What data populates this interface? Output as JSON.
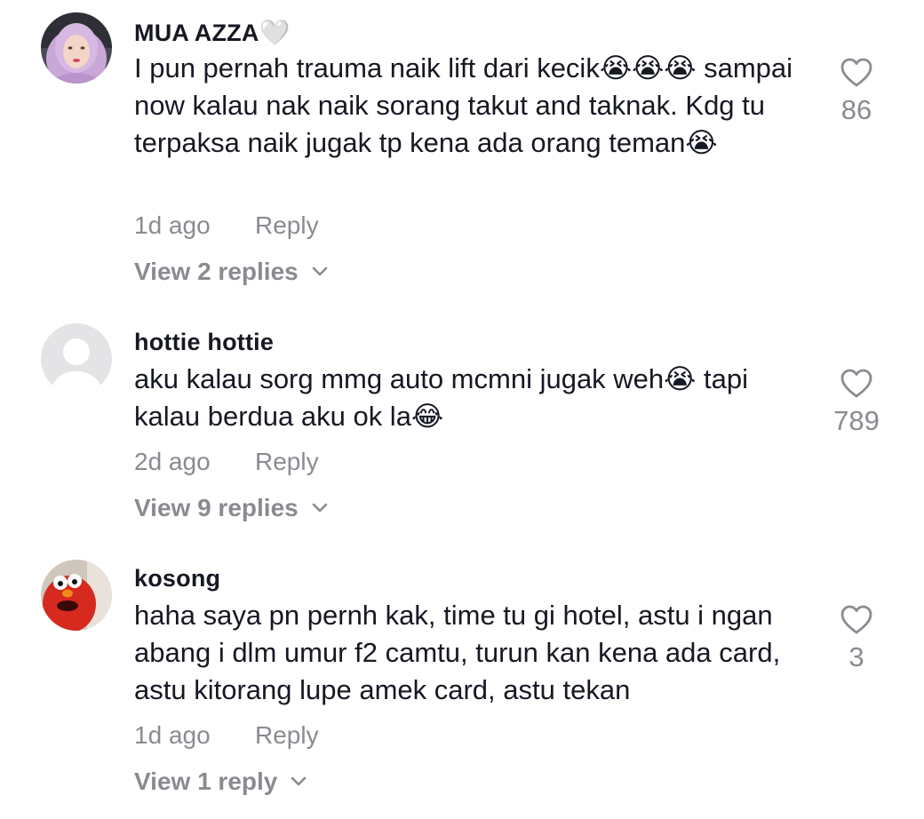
{
  "comments": [
    {
      "username": "MUA AZZA",
      "username_suffix": "🤍",
      "text": "I pun pernah trauma naik lift dari kecik😭😭😭 sampai now kalau nak naik sorang takut and taknak. Kdg tu terpaksa naik jugak tp kena ada orang teman😭",
      "time": "1d ago",
      "reply_label": "Reply",
      "view_replies": "View 2 replies",
      "likes": "86",
      "avatar": "hijab-woman-avatar"
    },
    {
      "username": "hottie hottie",
      "username_suffix": "",
      "text": "aku kalau sorg mmg auto mcmni jugak weh😭 tapi kalau berdua aku ok la😂",
      "time": "2d ago",
      "reply_label": "Reply",
      "view_replies": "View 9 replies",
      "likes": "789",
      "avatar": "default-avatar"
    },
    {
      "username": "kosong",
      "username_suffix": "",
      "text": "haha saya pn pernh kak, time tu gi hotel, astu i ngan abang i dlm umur f2 camtu, turun kan kena ada card, astu kitorang lupe amek card, astu tekan",
      "time": "1d ago",
      "reply_label": "Reply",
      "view_replies": "View 1 reply",
      "likes": "3",
      "avatar": "red-monster-avatar"
    }
  ],
  "colors": {
    "text": "#161823",
    "secondary": "#8a8b91",
    "background": "#ffffff"
  }
}
